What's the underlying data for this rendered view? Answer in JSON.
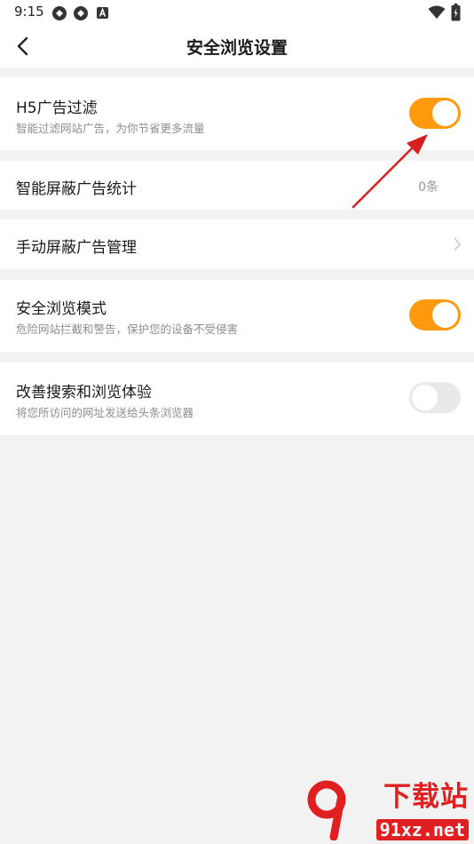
{
  "status_bar": {
    "time": "9:15"
  },
  "header": {
    "title": "安全浏览设置",
    "back_icon": "back-arrow-icon"
  },
  "settings": {
    "h5_filter": {
      "title": "H5广告过滤",
      "subtitle": "智能过滤网站广告，为你节省更多流量",
      "enabled": true
    },
    "smart_block_stats": {
      "title": "智能屏蔽广告统计",
      "value": "0条"
    },
    "manual_block": {
      "title": "手动屏蔽广告管理"
    },
    "safe_mode": {
      "title": "安全浏览模式",
      "subtitle": "危险网站拦截和警告，保护您的设备不受侵害",
      "enabled": true
    },
    "improve": {
      "title": "改善搜索和浏览体验",
      "subtitle": "将您所访问的网址发送给头条浏览器",
      "enabled": false
    }
  },
  "watermark": {
    "text_cn": "下载站",
    "text_url": "91xz.net"
  },
  "colors": {
    "accent": "#ff9a0e",
    "background": "#f2f2f2",
    "annotation_arrow": "#d81f1f",
    "watermark": "#e02020"
  }
}
